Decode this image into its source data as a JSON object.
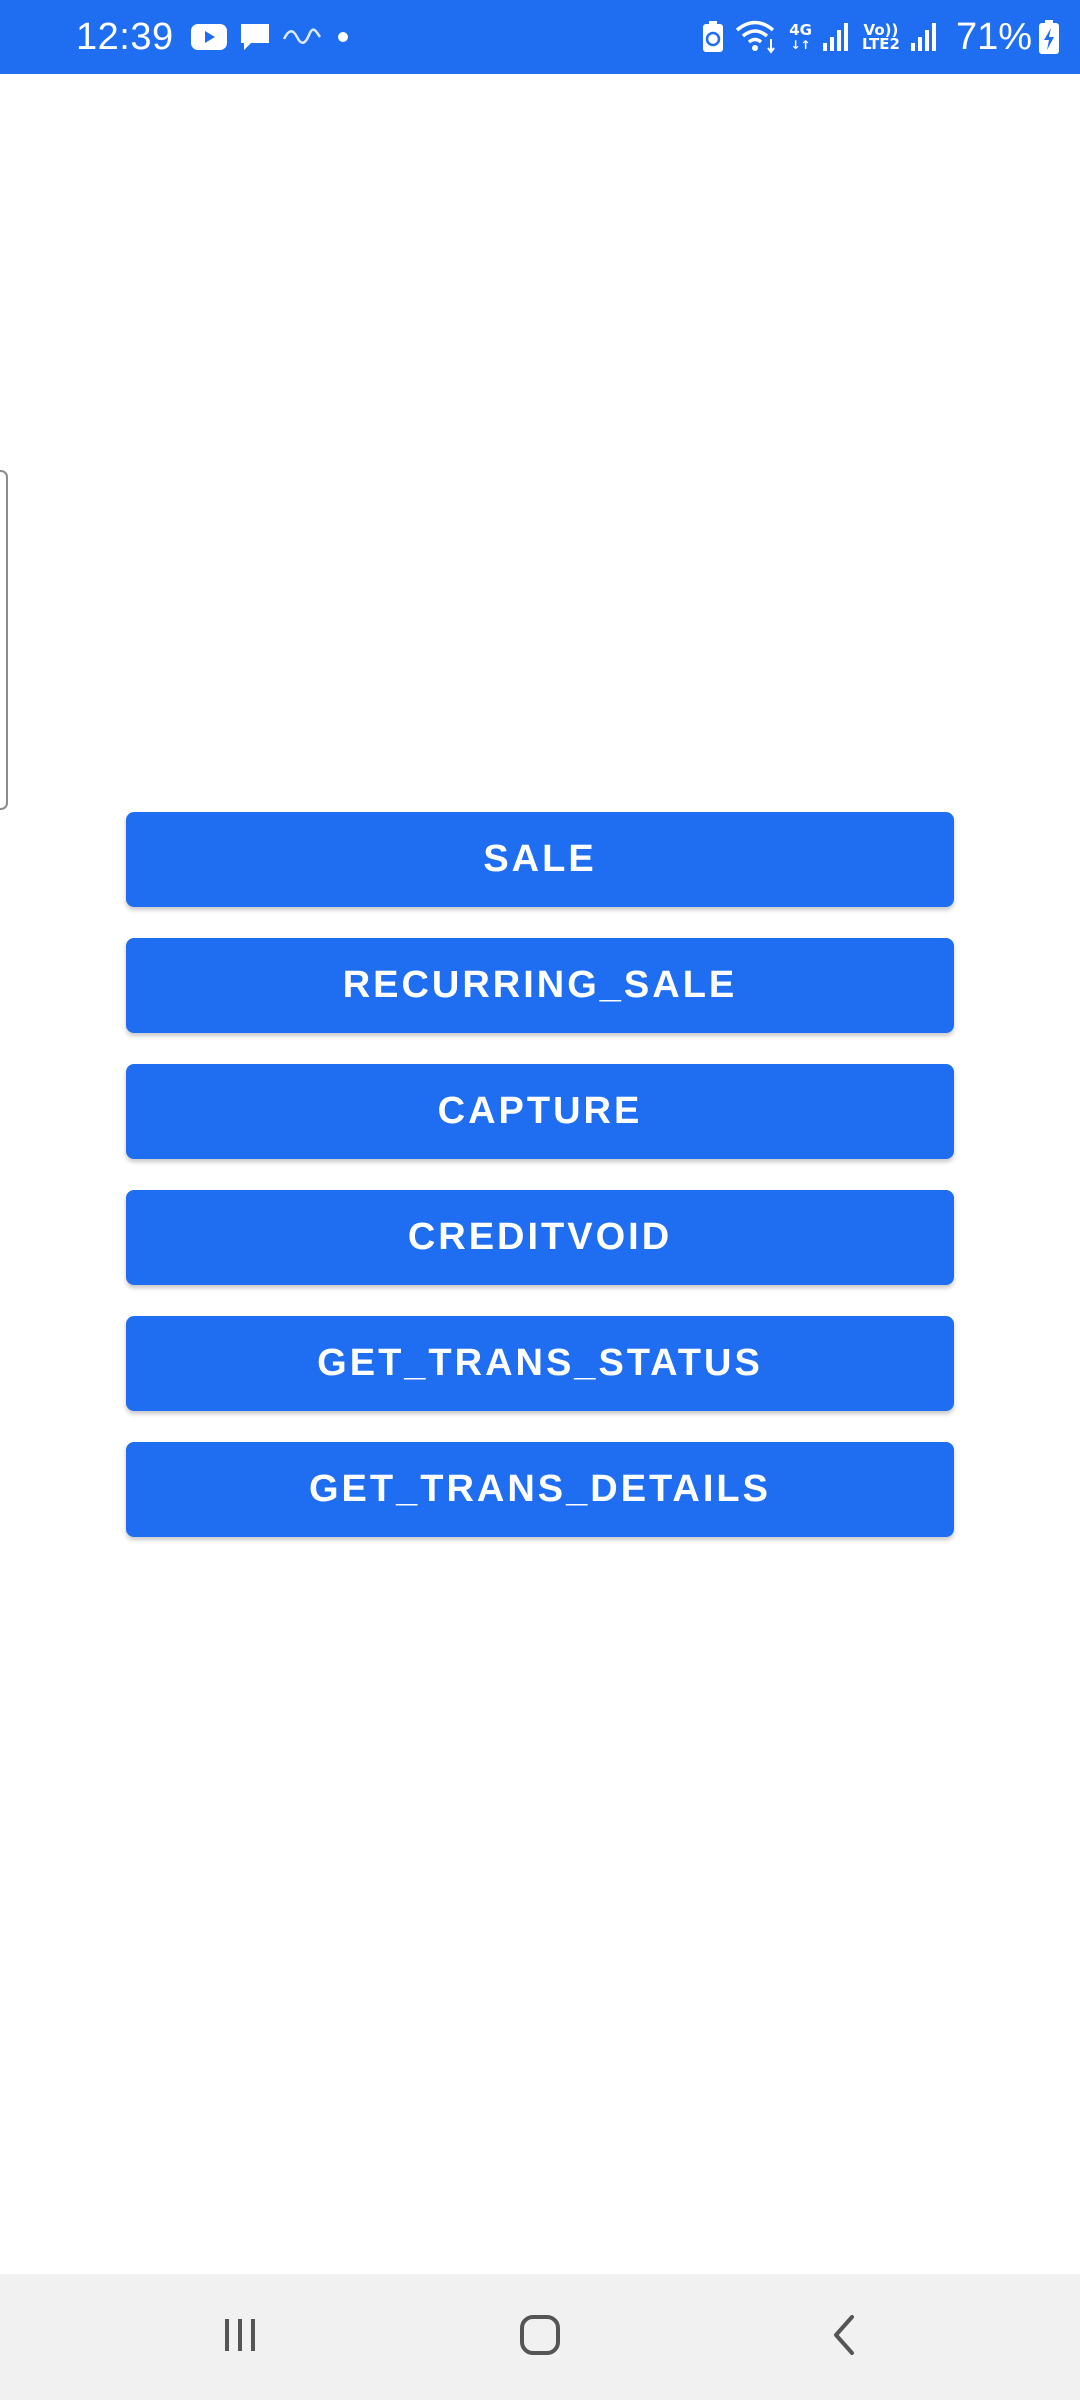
{
  "status_bar": {
    "time": "12:39",
    "network_4g": "4G",
    "volte_top": "Vo))",
    "volte_bottom": "LTE2",
    "battery": "71%",
    "icons": [
      "youtube-icon",
      "message-icon",
      "squiggle-icon",
      "dot-icon",
      "battery-saver-icon",
      "wifi-icon",
      "signal-icon",
      "battery-charging-icon"
    ],
    "background_color": "#1f6ef2"
  },
  "buttons": [
    {
      "label": "SALE"
    },
    {
      "label": "RECURRING_SALE"
    },
    {
      "label": "CAPTURE"
    },
    {
      "label": "CREDITVOID"
    },
    {
      "label": "GET_TRANS_STATUS"
    },
    {
      "label": "GET_TRANS_DETAILS"
    }
  ],
  "accent_color": "#1f6ef2",
  "nav_bar": {
    "items": [
      "recent-apps-icon",
      "home-icon",
      "back-icon"
    ]
  }
}
